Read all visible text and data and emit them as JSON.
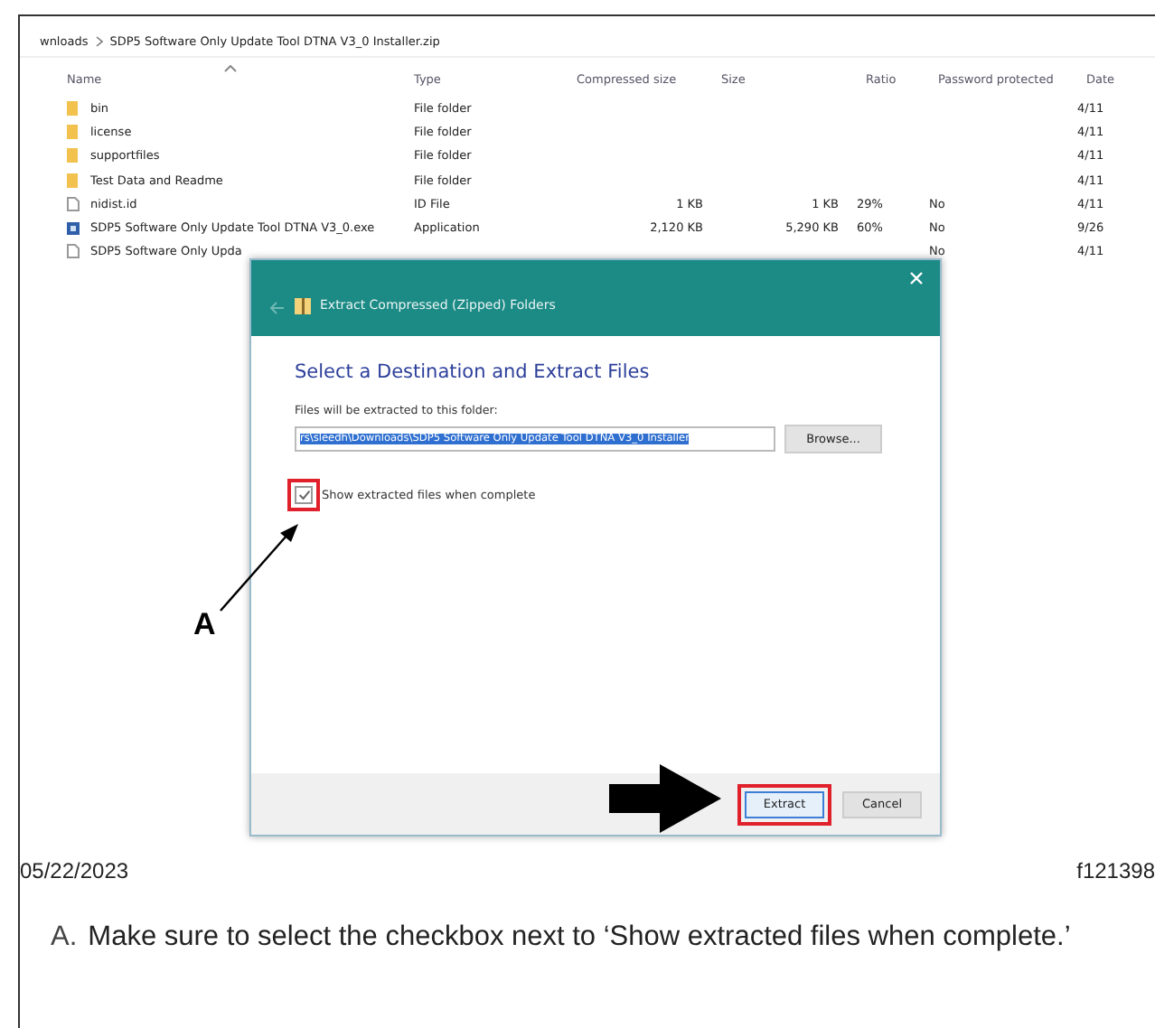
{
  "explorer": {
    "breadcrumb": [
      {
        "label": "wnloads"
      },
      {
        "label": "SDP5 Software Only Update Tool DTNA V3_0 Installer.zip"
      }
    ],
    "columns": [
      "Name",
      "Type",
      "Compressed size",
      "Size",
      "Ratio",
      "Password protected",
      "Date"
    ],
    "rows": [
      {
        "kind": "folder",
        "name": "bin",
        "type": "File folder",
        "compressed": "",
        "size": "",
        "ratio": "",
        "password": "",
        "date": "4/11"
      },
      {
        "kind": "folder",
        "name": "license",
        "type": "File folder",
        "compressed": "",
        "size": "",
        "ratio": "",
        "password": "",
        "date": "4/11"
      },
      {
        "kind": "folder",
        "name": "supportfiles",
        "type": "File folder",
        "compressed": "",
        "size": "",
        "ratio": "",
        "password": "",
        "date": "4/11"
      },
      {
        "kind": "folder",
        "name": "Test Data and Readme",
        "type": "File folder",
        "compressed": "",
        "size": "",
        "ratio": "",
        "password": "",
        "date": "4/11"
      },
      {
        "kind": "file",
        "name": "nidist.id",
        "type": "ID File",
        "compressed": "1 KB",
        "size": "1 KB",
        "ratio": "29%",
        "password": "No",
        "date": "4/11"
      },
      {
        "kind": "app",
        "name": "SDP5 Software Only Update Tool DTNA V3_0.exe",
        "type": "Application",
        "compressed": "2,120 KB",
        "size": "5,290 KB",
        "ratio": "60%",
        "password": "No",
        "date": "9/26"
      },
      {
        "kind": "file",
        "name": "SDP5 Software Only Upda",
        "type": "",
        "compressed": "",
        "size": "",
        "ratio": "",
        "password": "No",
        "date": "4/11"
      }
    ]
  },
  "dialog": {
    "title": "Extract Compressed (Zipped) Folders",
    "heading": "Select a Destination and Extract Files",
    "field_label": "Files will be extracted to this folder:",
    "field_value": "rs\\sleedh\\Downloads\\SDP5 Software Only Update Tool DTNA V3_0 Installer",
    "field_text_selected": true,
    "browse": "Browse...",
    "checkbox": {
      "label": "Show extracted files when complete",
      "checked": true
    },
    "buttons": [
      {
        "label": "Extract",
        "default": true
      },
      {
        "label": "Cancel",
        "default": false
      }
    ]
  },
  "callout": {
    "label": "A"
  },
  "caption": {
    "date": "05/22/2023",
    "figure_id": "f121398"
  },
  "note": {
    "label": "A.",
    "text": "Make sure to select the checkbox next to ‘Show extracted files when complete.’"
  }
}
